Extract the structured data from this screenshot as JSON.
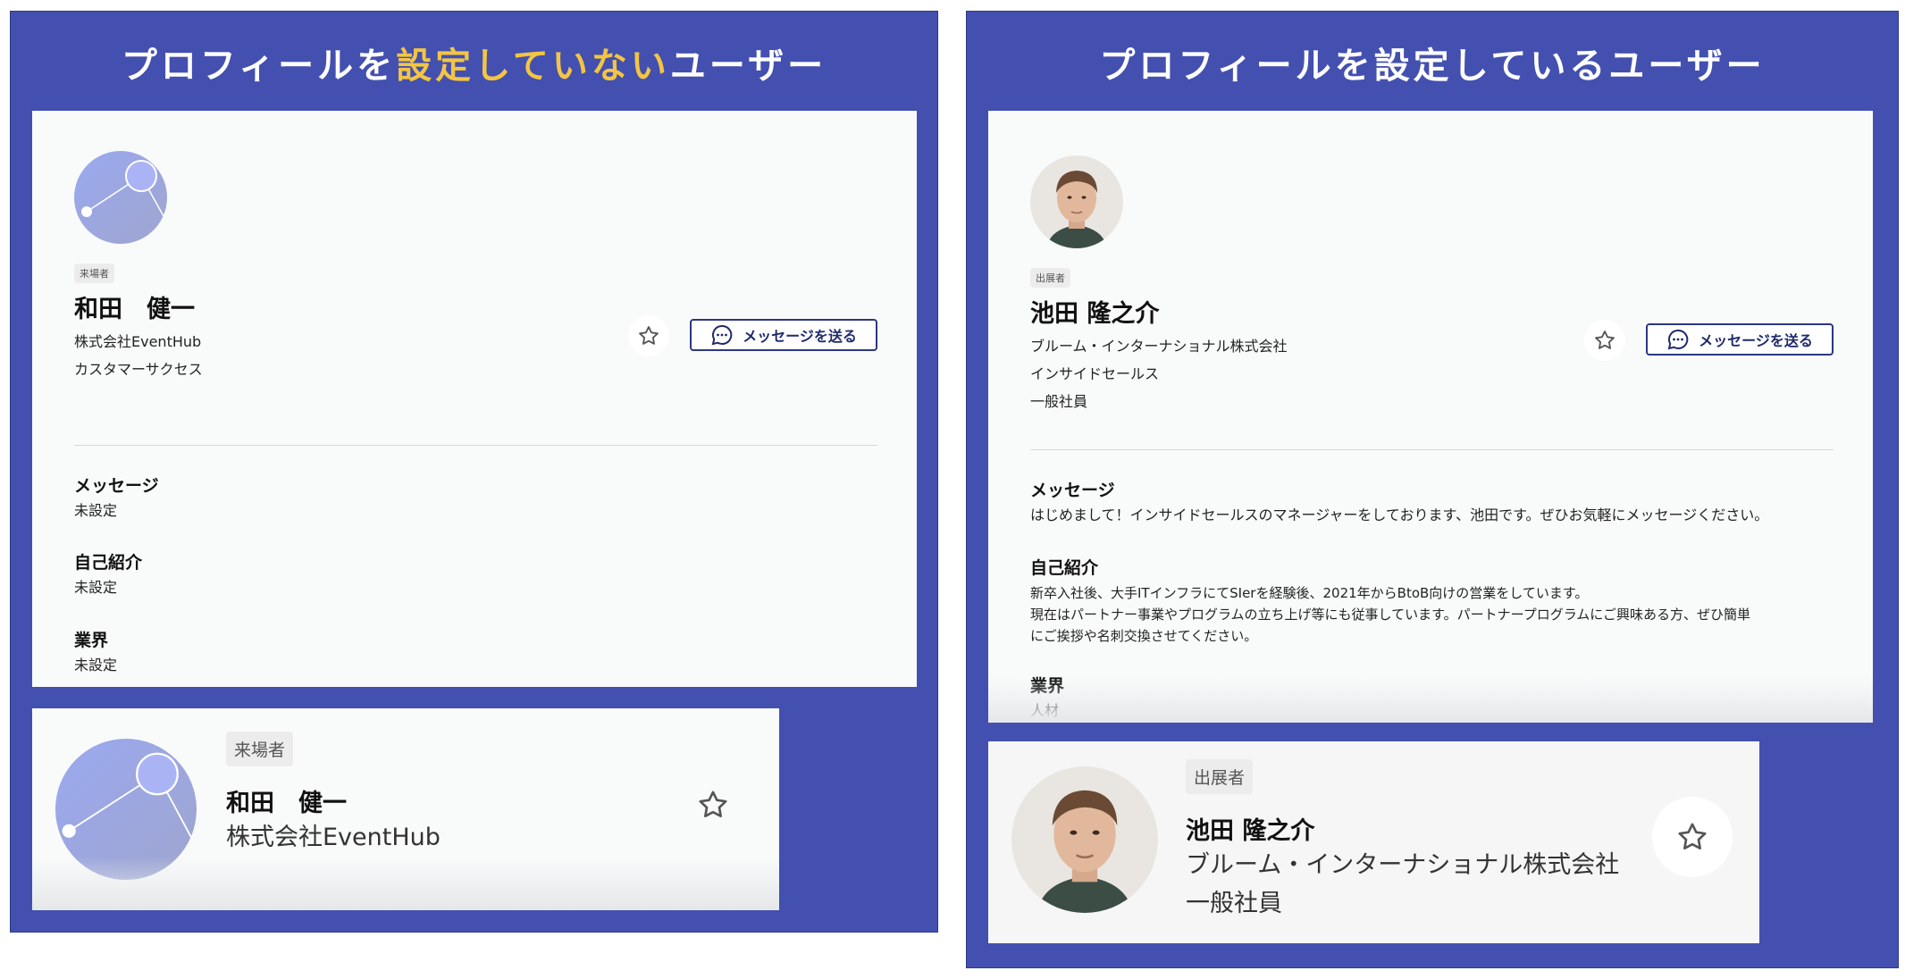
{
  "left": {
    "title_pre": "プロフィールを",
    "title_highlight": "設定していない",
    "title_post": "ユーザー",
    "detail": {
      "badge": "来場者",
      "name": "和田　健一",
      "company": "株式会社EventHub",
      "department": "カスタマーサクセス",
      "message_button": "メッセージを送る",
      "sections": [
        {
          "heading": "メッセージ",
          "value": "未設定"
        },
        {
          "heading": "自己紹介",
          "value": "未設定"
        },
        {
          "heading": "業界",
          "value": "未設定"
        }
      ]
    },
    "list_item": {
      "badge": "来場者",
      "name": "和田　健一",
      "company": "株式会社EventHub"
    }
  },
  "right": {
    "title": "プロフィールを設定しているユーザー",
    "detail": {
      "badge": "出展者",
      "name": "池田 隆之介",
      "company": "ブルーム・インターナショナル株式会社",
      "department": "インサイドセールス",
      "position": "一般社員",
      "message_button": "メッセージを送る",
      "sections": [
        {
          "heading": "メッセージ",
          "value": "はじめまして！インサイドセールスのマネージャーをしております、池田です。ぜひお気軽にメッセージください。"
        },
        {
          "heading": "自己紹介",
          "lines": [
            "新卒入社後、大手ITインフラにてSIerを経験後、2021年からBtoB向けの営業をしています。",
            "現在はパートナー事業やプログラムの立ち上げ等にも従事しています。パートナープログラムにご興味ある方、ぜひ簡単",
            "にご挨拶や名刺交換させてください。"
          ]
        },
        {
          "heading": "業界",
          "value": "人材"
        }
      ]
    },
    "list_item": {
      "badge": "出展者",
      "name": "池田 隆之介",
      "company": "ブルーム・インターナショナル株式会社",
      "position": "一般社員"
    }
  },
  "icons": [
    "default-avatar-icon",
    "star-icon",
    "chat-bubble-icon",
    "profile-photo"
  ],
  "colors": {
    "panel": "#4350b0",
    "highlight": "#f3c542",
    "button_border": "#2c3782"
  }
}
